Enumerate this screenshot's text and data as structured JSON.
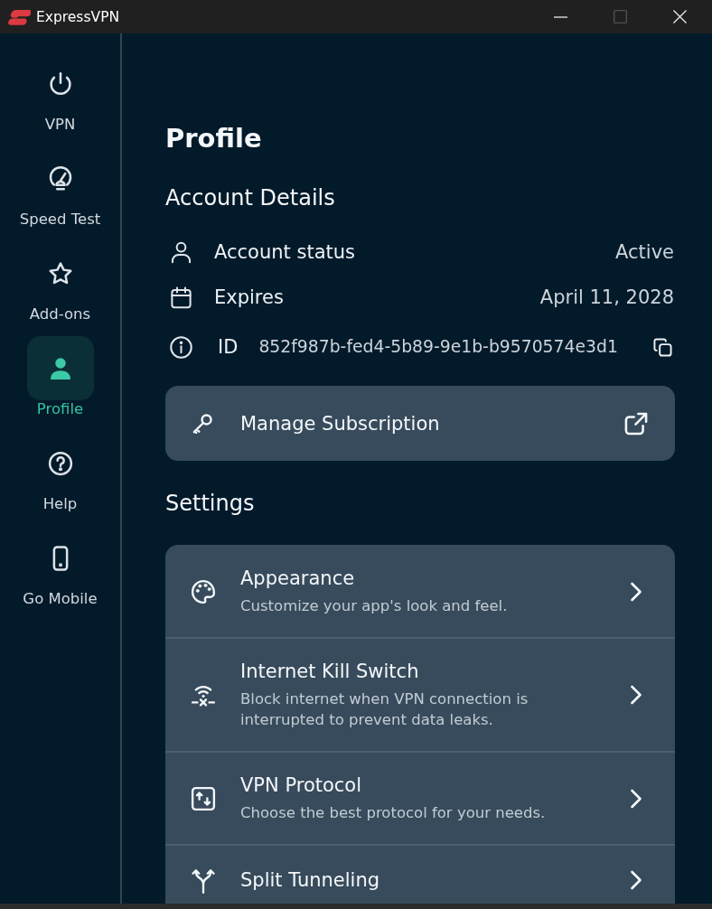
{
  "window": {
    "title": "ExpressVPN",
    "controls": [
      {
        "kind": "minimize",
        "disabled": false
      },
      {
        "kind": "maximize",
        "disabled": true
      },
      {
        "kind": "close",
        "disabled": false
      }
    ]
  },
  "sidebar": {
    "items": [
      {
        "label": "VPN",
        "selected": false
      },
      {
        "label": "Speed Test",
        "selected": false
      },
      {
        "label": "Add-ons",
        "selected": false
      },
      {
        "label": "Profile",
        "selected": true
      },
      {
        "label": "Help",
        "selected": false
      },
      {
        "label": "Go Mobile",
        "selected": false
      }
    ]
  },
  "page": {
    "title": "Profile"
  },
  "account_details": {
    "heading": "Account Details",
    "rows": [
      {
        "kind": "field",
        "label": "Account status",
        "value": "Active"
      },
      {
        "kind": "field",
        "label": "Expires",
        "value": "April 11, 2028"
      },
      {
        "kind": "id",
        "label": "ID",
        "value": "852f987b-fed4-5b89-9e1b-b9570574e3d1"
      }
    ]
  },
  "manage_subscription": {
    "label": "Manage Subscription"
  },
  "settings": {
    "heading": "Settings",
    "items": [
      {
        "title": "Appearance",
        "description": "Customize your app's look and feel."
      },
      {
        "title": "Internet Kill Switch",
        "description": "Block internet when VPN connection is interrupted to prevent data leaks."
      },
      {
        "title": "VPN Protocol",
        "description": "Choose the best protocol for your needs."
      },
      {
        "title": "Split Tunneling"
      }
    ]
  }
}
